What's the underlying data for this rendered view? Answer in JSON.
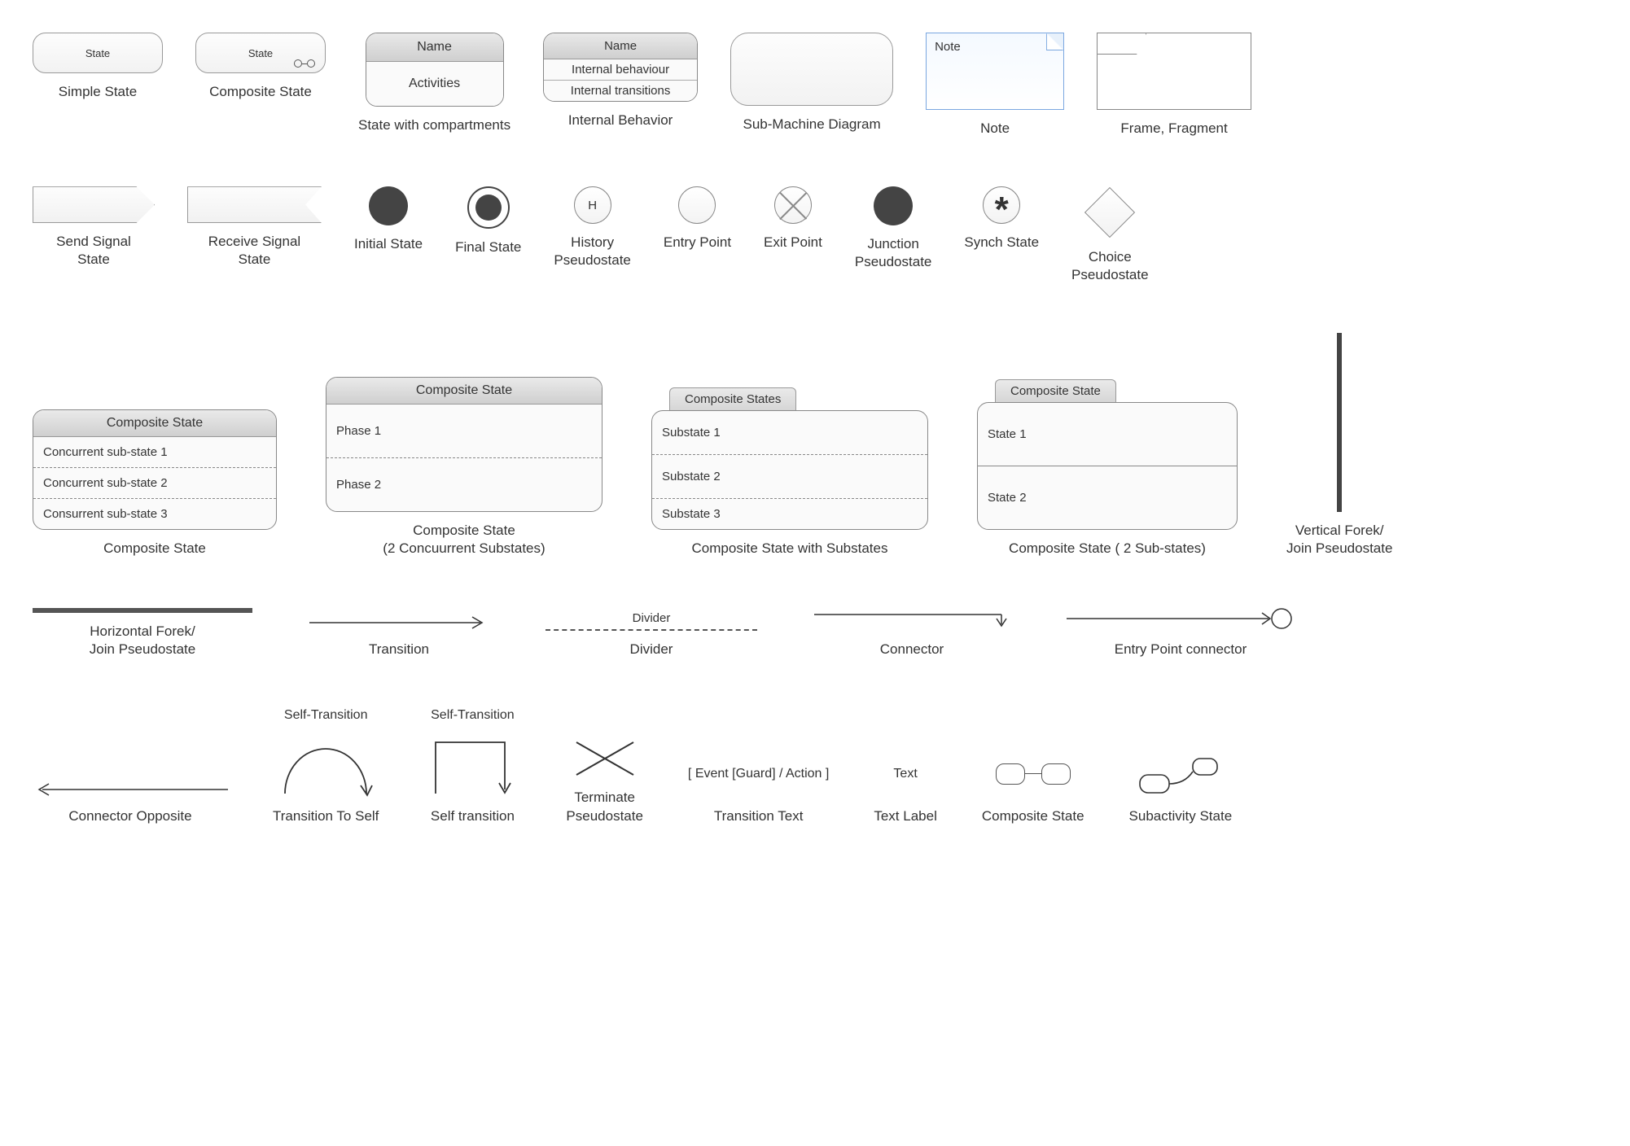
{
  "row1": {
    "simpleState": {
      "text": "State",
      "label": "Simple State"
    },
    "compositeState": {
      "text": "State",
      "label": "Composite State"
    },
    "compartments": {
      "name": "Name",
      "activities": "Activities",
      "label": "State with compartments"
    },
    "internal": {
      "name": "Name",
      "r1": "Internal behaviour",
      "r2": "Internal transitions",
      "label": "Internal Behavior"
    },
    "submachine": {
      "label": "Sub-Machine Diagram"
    },
    "note": {
      "text": "Note",
      "label": "Note"
    },
    "frame": {
      "label": "Frame, Fragment"
    }
  },
  "row2": {
    "sendSignal": {
      "label": "Send Signal\nState"
    },
    "recvSignal": {
      "label": "Receive Signal\nState"
    },
    "initial": {
      "label": "Initial State"
    },
    "final": {
      "label": "Final State"
    },
    "history": {
      "letter": "H",
      "label": "History\nPseudostate"
    },
    "entry": {
      "label": "Entry Point"
    },
    "exit": {
      "label": "Exit Point"
    },
    "junction": {
      "label": "Junction\nPseudostate"
    },
    "synch": {
      "glyph": "*",
      "label": "Synch State"
    },
    "choice": {
      "label": "Choice\nPseudostate"
    }
  },
  "row3": {
    "comp3": {
      "title": "Composite State",
      "rows": [
        "Concurrent sub-state 1",
        "Concurrent sub-state 2",
        "Consurrent sub-state 3"
      ],
      "label": "Composite State"
    },
    "comp2": {
      "title": "Composite State",
      "rows": [
        "Phase 1",
        "Phase 2"
      ],
      "label": "Composite State\n(2 Concuurrent Substates)"
    },
    "compTabSub": {
      "tab": "Composite States",
      "rows": [
        "Substate 1",
        "Substate 2",
        "Substate 3"
      ],
      "label": "Composite State with Substates"
    },
    "compTab2": {
      "tab": "Composite State",
      "rows": [
        "State 1",
        "State 2"
      ],
      "label": "Composite State ( 2 Sub-states)"
    },
    "vfork": {
      "label": "Vertical Forek/\nJoin Pseudostate"
    }
  },
  "row4": {
    "hfork": {
      "label": "Horizontal Forek/\nJoin Pseudostate"
    },
    "transition": {
      "label": "Transition"
    },
    "divider": {
      "text": "Divider",
      "label": "Divider"
    },
    "connector": {
      "label": "Connector"
    },
    "entryConn": {
      "label": "Entry Point connector"
    }
  },
  "row5": {
    "connOpp": {
      "label": "Connector Opposite"
    },
    "selfTrans": {
      "text": "Self-Transition",
      "label": "Transition To Self"
    },
    "selfTrans2": {
      "text": "Self-Transition",
      "label": "Self transition"
    },
    "terminate": {
      "label": "Terminate\nPseudostate"
    },
    "transText": {
      "text": "[ Event [Guard] / Action ]",
      "label": "Transition Text"
    },
    "textLabel": {
      "text": "Text",
      "label": "Text Label"
    },
    "compStateSmall": {
      "label": "Composite State"
    },
    "subactivity": {
      "label": "Subactivity State"
    }
  }
}
